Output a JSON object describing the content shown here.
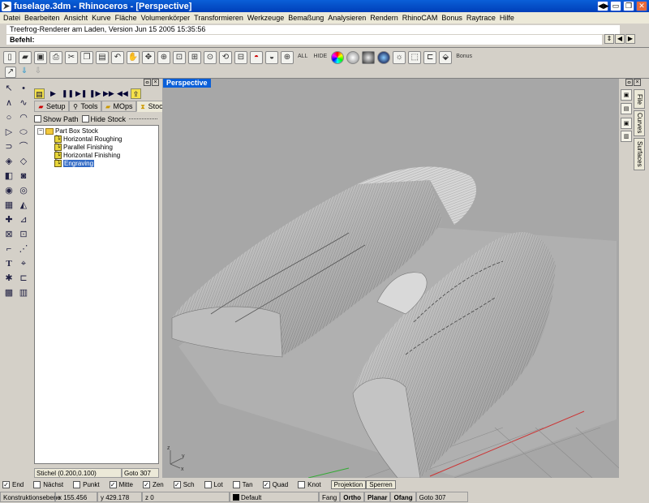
{
  "window": {
    "title": "fuselage.3dm - Rhinoceros - [Perspective]",
    "buttons": [
      "◀▶",
      "▭",
      "❐",
      "✕"
    ]
  },
  "menu": [
    "Datei",
    "Bearbeiten",
    "Ansicht",
    "Kurve",
    "Fläche",
    "Volumenkörper",
    "Transformieren",
    "Werkzeuge",
    "Bemaßung",
    "Analysieren",
    "Rendern",
    "RhinoCAM",
    "Bonus",
    "Raytrace",
    "Hilfe"
  ],
  "command": {
    "history": "Treefrog-Renderer am Laden, Version Jun 15 2005 15:35:56",
    "prompt": "Befehl:"
  },
  "toolbar": {
    "all_label": "ALL",
    "hide_label": "HIDE",
    "bonus_label": "Bonus"
  },
  "panel": {
    "tabs": [
      "Setup",
      "Tools",
      "MOps",
      "Stock"
    ],
    "active_tab": "Stock",
    "show_path": "Show Path",
    "hide_stock": "Hide Stock",
    "tree": {
      "root": "Part Box Stock",
      "children": [
        "Horizontal Roughing",
        "Parallel Finishing",
        "Horizontal Finishing",
        "Engraving"
      ],
      "selected": "Engraving"
    },
    "status_left": "Stichel (0.200,0.100)",
    "status_right": "Goto 307"
  },
  "viewport": {
    "label": "Perspective",
    "axis_x": "x",
    "axis_y": "y",
    "axis_z": "z"
  },
  "right_panel": {
    "tabs": [
      "File",
      "Curves",
      "Surfaces"
    ]
  },
  "osnap": {
    "items": [
      {
        "label": "End",
        "checked": true
      },
      {
        "label": "Nächst",
        "checked": false
      },
      {
        "label": "Punkt",
        "checked": false
      },
      {
        "label": "Mitte",
        "checked": true
      },
      {
        "label": "Zen",
        "checked": true
      },
      {
        "label": "Sch",
        "checked": true
      },
      {
        "label": "Lot",
        "checked": false
      },
      {
        "label": "Tan",
        "checked": false
      },
      {
        "label": "Quad",
        "checked": true
      },
      {
        "label": "Knot",
        "checked": false
      }
    ],
    "projektion": "Projektion",
    "sperren": "Sperren"
  },
  "status": {
    "plane": "Konstruktionsebene",
    "x": "x 155.456",
    "y": "y 429.178",
    "z": "z 0",
    "layer": "Default",
    "fang": "Fang",
    "ortho": "Ortho",
    "planar": "Planar",
    "ofang": "Ofang",
    "goto": "Goto 307"
  }
}
